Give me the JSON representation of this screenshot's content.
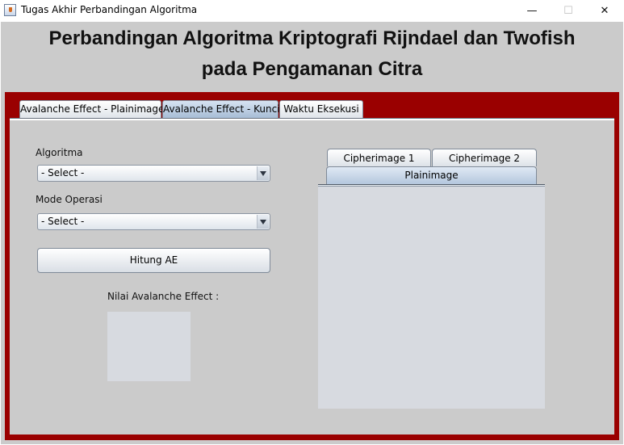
{
  "window": {
    "title": "Tugas Akhir Perbandingan Algoritma",
    "controls": {
      "minimize": "—",
      "maximize": "☐",
      "close": "✕"
    }
  },
  "header": {
    "title_line1": "Perbandingan Algoritma Kriptografi Rijndael dan Twofish",
    "title_line2": "pada Pengamanan Citra"
  },
  "tabs": [
    {
      "label": "Avalanche Effect - Plainimage",
      "selected": false
    },
    {
      "label": "Avalanche Effect - Kunci",
      "selected": true
    },
    {
      "label": "Waktu Eksekusi",
      "selected": false
    }
  ],
  "form": {
    "algoritma_label": "Algoritma",
    "algoritma_value": "- Select -",
    "mode_label": "Mode Operasi",
    "mode_value": "- Select -",
    "hitung_button": "Hitung AE",
    "result_label": "Nilai Avalanche Effect :"
  },
  "image_tabs": {
    "row1": [
      "Cipherimage 1",
      "Cipherimage 2"
    ],
    "selected": "Plainimage"
  },
  "colors": {
    "panel_border": "#9a0000",
    "background": "#cbcbcb",
    "selected_tab": "#a7bdd6",
    "display_box": "#d7dae0"
  }
}
